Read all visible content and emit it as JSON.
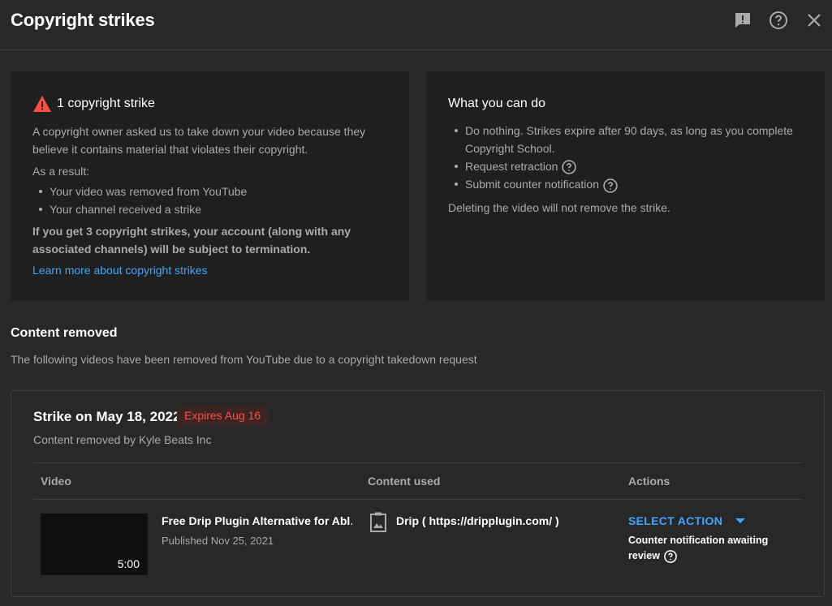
{
  "header": {
    "title": "Copyright strikes",
    "icons": [
      "feedback-icon",
      "help-icon",
      "close-icon"
    ]
  },
  "strike_card": {
    "heading": "1 copyright strike",
    "description": "A copyright owner asked us to take down your video because they believe it contains material that violates their copyright.",
    "result_label": "As a result:",
    "results": [
      "Your video was removed from YouTube",
      "Your channel received a strike"
    ],
    "warning": "If you get 3 copyright strikes, your account (along with any associated channels) will be subject to termination.",
    "learn_more": "Learn more about copyright strikes",
    "warning_color": "#ff4e45"
  },
  "actions_card": {
    "heading": "What you can do",
    "items": [
      "Do nothing. Strikes expire after 90 days, as long as you complete Copyright School.",
      "Request retraction",
      "Submit counter notification"
    ],
    "note": "Deleting the video will not remove the strike."
  },
  "content_removed": {
    "title": "Content removed",
    "description": "The following videos have been removed from YouTube due to a copyright takedown request"
  },
  "strike": {
    "title": "Strike on May 18, 2022",
    "expires": "Expires Aug 16",
    "removed_by": "Content removed by Kyle Beats Inc",
    "columns": [
      "Video",
      "Content used",
      "Actions"
    ],
    "row": {
      "duration": "5:00",
      "video_title": "Free Drip Plugin Alternative for Abl…",
      "published": "Published Nov 25, 2021",
      "content_used": "Drip ( https://dripplugin.com/ )",
      "action_label": "SELECT ACTION",
      "status": "Counter notification awaiting review"
    }
  },
  "colors": {
    "background": "#282828",
    "card": "#1f1f1f",
    "accent": "#3ea6ff",
    "danger": "#ff4e45"
  }
}
